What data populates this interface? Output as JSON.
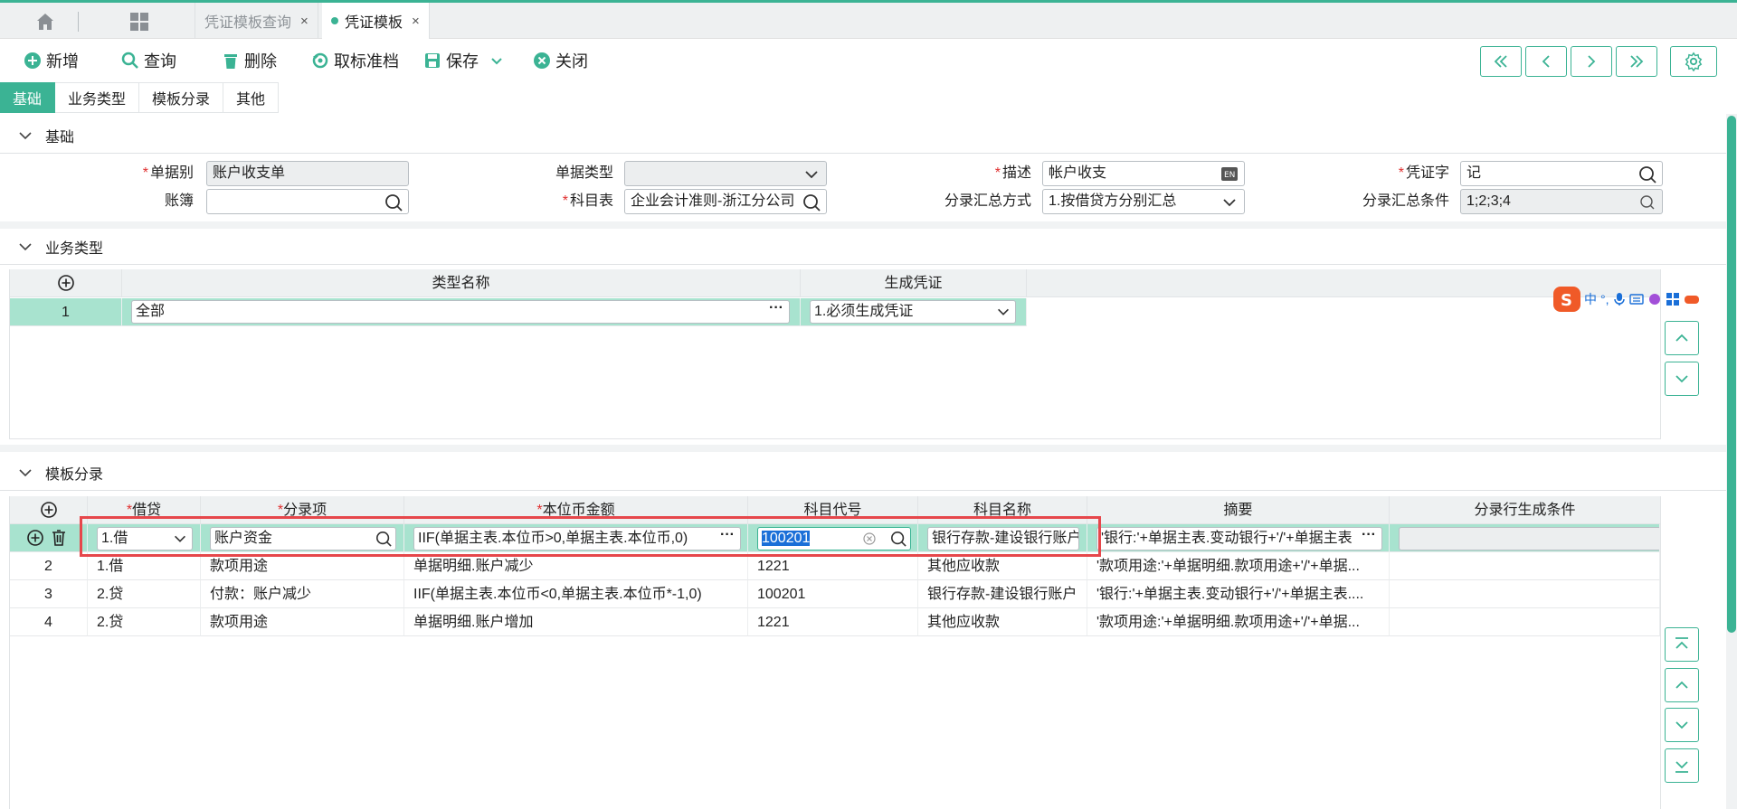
{
  "window_tabs": [
    {
      "label": "凭证模板查询",
      "close": "×"
    },
    {
      "label": "凭证模板",
      "close": "×"
    }
  ],
  "toolbar": {
    "new": "新增",
    "query": "查询",
    "delete": "删除",
    "cancel_archive": "取标准档",
    "save": "保存",
    "close": "关闭"
  },
  "subtabs": [
    "基础",
    "业务类型",
    "模板分录",
    "其他"
  ],
  "basic": {
    "title": "基础",
    "doc_type_label": "单据别",
    "doc_type_value": "账户收支单",
    "bill_type_label": "单据类型",
    "bill_type_value": "",
    "desc_label": "描述",
    "desc_value": "帐户收支",
    "voucher_word_label": "凭证字",
    "voucher_word_value": "记",
    "ledger_label": "账簿",
    "ledger_value": "",
    "account_table_label": "科目表",
    "account_table_value": "企业会计准则-浙江分公司",
    "summary_mode_label": "分录汇总方式",
    "summary_mode_value": "1.按借贷方分别汇总",
    "summary_cond_label": "分录汇总条件",
    "summary_cond_value": "1;2;3;4"
  },
  "biz": {
    "title": "业务类型",
    "headers": {
      "name": "类型名称",
      "voucher": "生成凭证"
    },
    "row": {
      "no": "1",
      "name": "全部",
      "voucher": "1.必须生成凭证"
    }
  },
  "entries": {
    "title": "模板分录",
    "headers": {
      "dc": "借贷",
      "item": "分录项",
      "amount": "本位币金额",
      "code": "科目代号",
      "acct_name": "科目名称",
      "summary": "摘要",
      "cond": "分录行生成条件"
    },
    "edit_row": {
      "dc": "1.借",
      "item": "账户资金",
      "amount": "IIF(单据主表.本位币>0,单据主表.本位币,0)",
      "code": "100201",
      "acct_name": "银行存款-建设银行账户",
      "summary": "'银行:'+单据主表.变动银行+'/'+单据主表",
      "cond": ""
    },
    "rows": [
      {
        "no": "2",
        "dc": "1.借",
        "item": "款项用途",
        "amount": "单据明细.账户减少",
        "code": "1221",
        "acct_name": "其他应收款",
        "summary": "'款项用途:'+单据明细.款项用途+'/'+单据..."
      },
      {
        "no": "3",
        "dc": "2.贷",
        "item": "付款：账户减少",
        "amount": "IIF(单据主表.本位币<0,单据主表.本位币*-1,0)",
        "code": "100201",
        "acct_name": "银行存款-建设银行账户",
        "summary": "'银行:'+单据主表.变动银行+'/'+单据主表...."
      },
      {
        "no": "4",
        "dc": "2.贷",
        "item": "款项用途",
        "amount": "单据明细.账户增加",
        "code": "1221",
        "acct_name": "其他应收款",
        "summary": "'款项用途:'+单据明细.款项用途+'/'+单据..."
      }
    ]
  },
  "ime": {
    "lang": "中",
    "punct": "°,"
  },
  "colors": {
    "accent": "#3bb394",
    "required": "#e03030",
    "highlight_box": "#e6474b"
  }
}
